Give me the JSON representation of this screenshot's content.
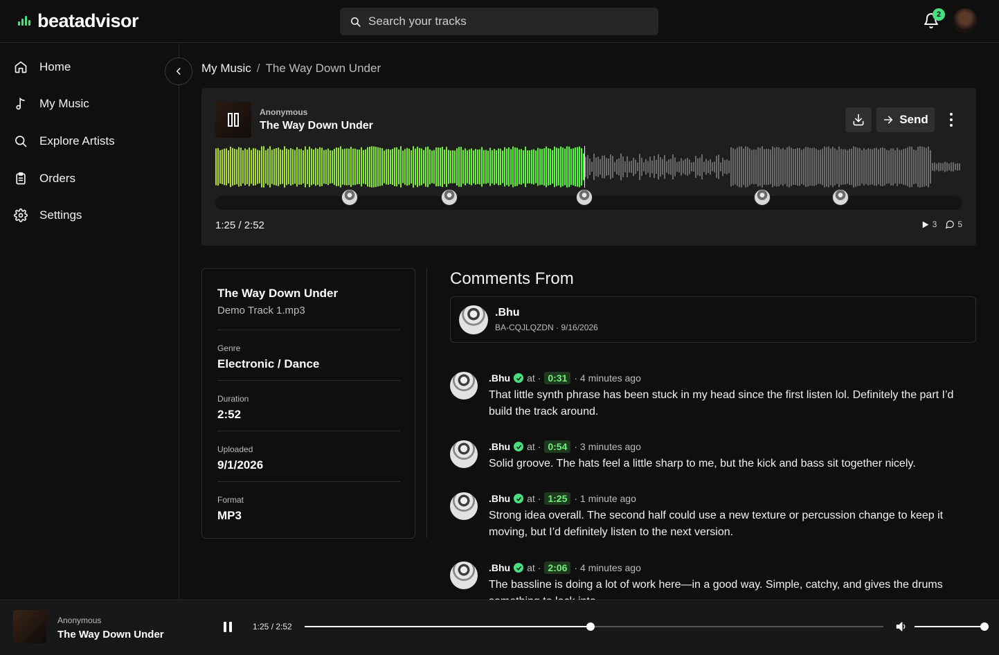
{
  "brand": {
    "name": "beatadvisor",
    "accent": "#4ade80"
  },
  "header": {
    "search_placeholder": "Search your tracks",
    "notification_count": "2"
  },
  "sidebar": {
    "items": [
      {
        "label": "Home",
        "icon": "home-icon"
      },
      {
        "label": "My Music",
        "icon": "music-note-icon"
      },
      {
        "label": "Explore Artists",
        "icon": "search-icon"
      },
      {
        "label": "Orders",
        "icon": "clipboard-icon"
      },
      {
        "label": "Settings",
        "icon": "gear-icon"
      }
    ]
  },
  "breadcrumb": {
    "root": "My Music",
    "separator": "/",
    "current": "The Way Down Under"
  },
  "player": {
    "artist": "Anonymous",
    "title": "The Way Down Under",
    "send_label": "Send",
    "time": "1:25 / 2:52",
    "progress_fraction": 0.494,
    "plays": "3",
    "comments": "5",
    "comment_marker_times": [
      "0:31",
      "0:54",
      "1:25",
      "2:06",
      "2:24"
    ]
  },
  "details": {
    "title": "The Way Down Under",
    "file": "Demo Track 1.mp3",
    "fields": [
      {
        "label": "Genre",
        "value": "Electronic / Dance"
      },
      {
        "label": "Duration",
        "value": "2:52"
      },
      {
        "label": "Uploaded",
        "value": "9/1/2026"
      },
      {
        "label": "Format",
        "value": "MP3"
      }
    ]
  },
  "comments_section": {
    "title": "Comments From",
    "from": {
      "name": ".Bhu",
      "meta": "BA-CQJLQZDN · 9/16/2026"
    },
    "items": [
      {
        "name": ".Bhu",
        "at": "at ·",
        "timestamp": "0:31",
        "ago": "· 4 minutes ago",
        "text": "That little synth phrase has been stuck in my head since the first listen lol. Definitely the part I’d build the track around."
      },
      {
        "name": ".Bhu",
        "at": "at ·",
        "timestamp": "0:54",
        "ago": "· 3 minutes ago",
        "text": "Solid groove. The hats feel a little sharp to me, but the kick and bass sit together nicely."
      },
      {
        "name": ".Bhu",
        "at": "at ·",
        "timestamp": "1:25",
        "ago": "· 1 minute ago",
        "text": "Strong idea overall. The second half could use a new texture or percussion change to keep it moving, but I’d definitely listen to the next version."
      },
      {
        "name": ".Bhu",
        "at": "at ·",
        "timestamp": "2:06",
        "ago": "· 4 minutes ago",
        "text": "The bassline is doing a lot of work here—in a good way. Simple, catchy, and gives the drums something to lock into."
      }
    ]
  },
  "bottom_player": {
    "artist": "Anonymous",
    "title": "The Way Down Under",
    "time": "1:25 / 2:52",
    "progress_fraction": 0.494,
    "volume_fraction": 1.0
  }
}
